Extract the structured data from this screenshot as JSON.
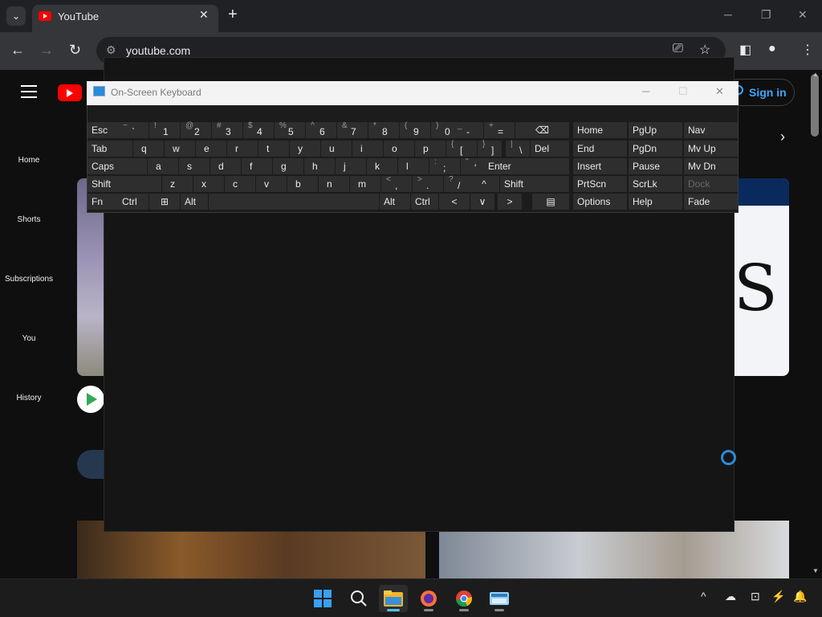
{
  "browser": {
    "tab_title": "YouTube",
    "url": "youtube.com",
    "new_tab_symbol": "+",
    "tab_close_symbol": "✕",
    "window_controls": [
      "─",
      "❐",
      "✕"
    ]
  },
  "youtube": {
    "sidebar": [
      "Home",
      "Shorts",
      "Subscriptions",
      "You",
      "History"
    ],
    "sign_in_label": "Sign in"
  },
  "osk": {
    "title": "On-Screen Keyboard",
    "controls": [
      "─",
      "☐",
      "✕"
    ],
    "rows": [
      [
        "Esc",
        "~ `",
        "! 1",
        "@ 2",
        "# 3",
        "$ 4",
        "% 5",
        "^ 6",
        "& 7",
        "* 8",
        "( 9",
        ") 0",
        "_ -",
        "+ =",
        "⌫",
        "Home",
        "PgUp",
        "Nav"
      ],
      [
        "Tab",
        "q",
        "w",
        "e",
        "r",
        "t",
        "y",
        "u",
        "i",
        "o",
        "p",
        "{ [",
        "} ]",
        "| \\",
        "Del",
        "End",
        "PgDn",
        "Mv Up"
      ],
      [
        "Caps",
        "a",
        "s",
        "d",
        "f",
        "g",
        "h",
        "j",
        "k",
        "l",
        ": ;",
        "\" '",
        "Enter",
        "Insert",
        "Pause",
        "Mv Dn"
      ],
      [
        "Shift",
        "z",
        "x",
        "c",
        "v",
        "b",
        "n",
        "m",
        "< ,",
        "> .",
        "? /",
        "^",
        "Shift",
        "PrtScn",
        "ScrLk",
        "Dock"
      ],
      [
        "Fn",
        "Ctrl",
        "⊞",
        "Alt",
        "",
        "Alt",
        "Ctrl",
        "<",
        "∨",
        ">",
        "▤",
        "Options",
        "Help",
        "Fade"
      ]
    ]
  },
  "taskbar": {
    "apps": [
      "windows-start",
      "search",
      "file-explorer",
      "firefox",
      "chrome",
      "on-screen-keyboard"
    ],
    "tray": [
      "^",
      "☁",
      "⊡",
      "⚡",
      "🔔"
    ]
  }
}
